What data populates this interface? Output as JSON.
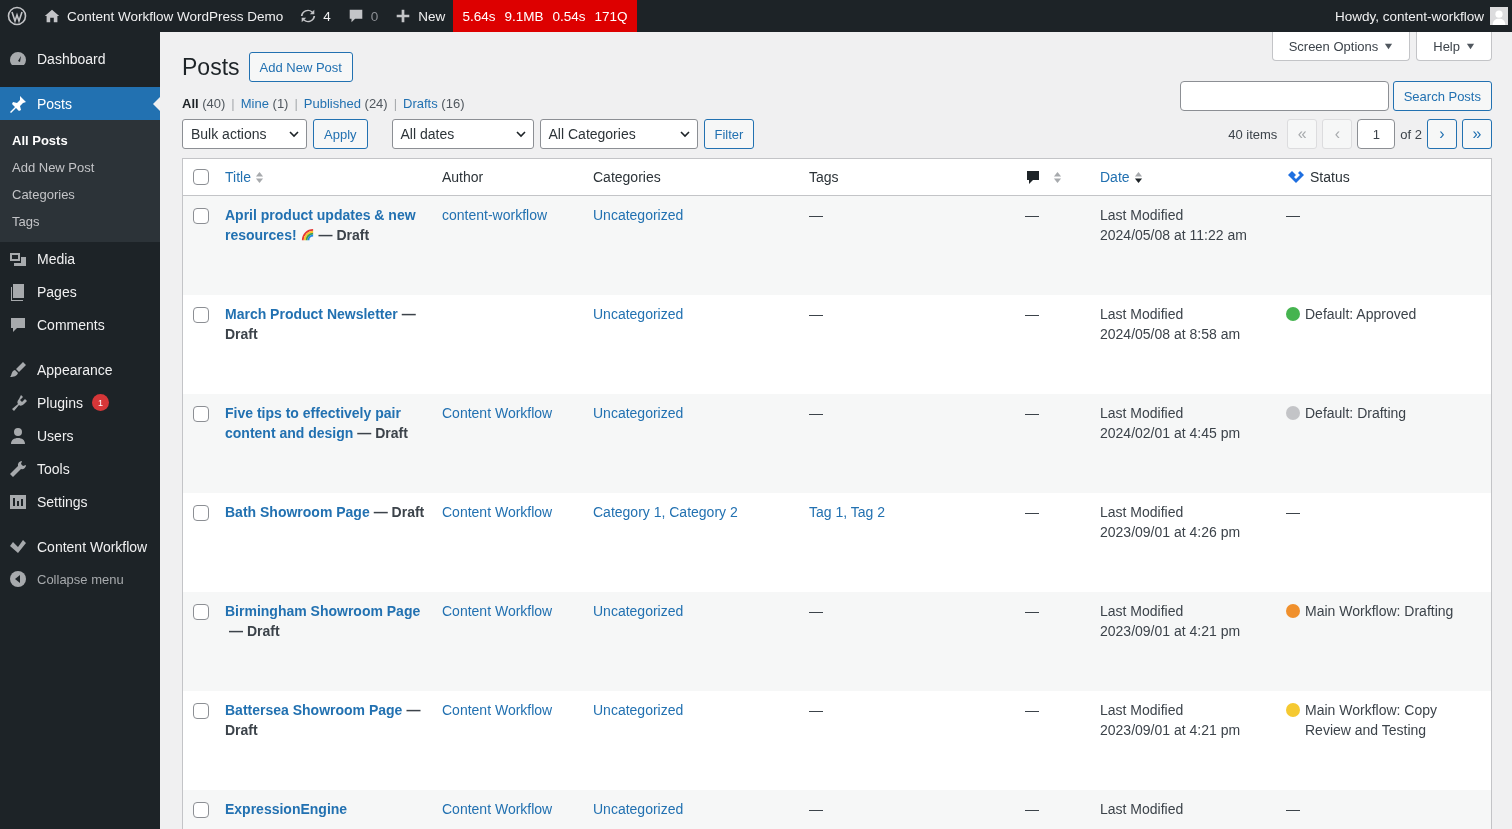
{
  "admin_bar": {
    "site_title": "Content Workflow WordPress Demo",
    "updates_count": "4",
    "comments_count": "0",
    "new_label": "New",
    "perf": [
      "5.64s",
      "9.1MB",
      "0.54s",
      "171Q"
    ],
    "greeting": "Howdy, content-workflow"
  },
  "sidebar": {
    "groups": [
      [
        {
          "label": "Dashboard",
          "selected": false
        }
      ],
      [
        {
          "label": "Posts",
          "selected": true,
          "children": [
            {
              "label": "All Posts",
              "selected": true
            },
            {
              "label": "Add New Post",
              "selected": false
            },
            {
              "label": "Categories",
              "selected": false
            },
            {
              "label": "Tags",
              "selected": false
            }
          ]
        },
        {
          "label": "Media",
          "selected": false
        },
        {
          "label": "Pages",
          "selected": false
        },
        {
          "label": "Comments",
          "selected": false
        }
      ],
      [
        {
          "label": "Appearance",
          "selected": false
        },
        {
          "label": "Plugins",
          "selected": false,
          "badge": "1"
        },
        {
          "label": "Users",
          "selected": false
        },
        {
          "label": "Tools",
          "selected": false
        },
        {
          "label": "Settings",
          "selected": false
        }
      ],
      [
        {
          "label": "Content Workflow",
          "selected": false
        }
      ]
    ],
    "collapse_label": "Collapse menu"
  },
  "screen_tabs": [
    "Screen Options",
    "Help"
  ],
  "page_title": "Posts",
  "add_new": "Add New Post",
  "views": [
    {
      "label": "All",
      "count": "(40)",
      "selected": true
    },
    {
      "separator": "|",
      "label": "Mine",
      "count": "(1)",
      "selected": false
    },
    {
      "separator": "|",
      "label": "Published",
      "count": "(24)",
      "selected": false
    },
    {
      "separator": "|",
      "label": "Drafts",
      "count": "(16)",
      "selected": false
    }
  ],
  "search": {
    "button": "Search Posts"
  },
  "filters": {
    "bulk": "Bulk actions",
    "apply": "Apply",
    "dates": "All dates",
    "categories": "All Categories",
    "filter": "Filter"
  },
  "pagination": {
    "count": "40 items",
    "first": {
      "label": "«",
      "disabled": true
    },
    "prev": {
      "label": "‹",
      "disabled": true
    },
    "page": "1",
    "of": "of 2",
    "next": {
      "label": "›",
      "disabled": false
    },
    "last": {
      "label": "»",
      "disabled": false
    }
  },
  "table": {
    "select_all_checked": false,
    "columns": [
      {
        "label": "Title",
        "sorted": false
      },
      {
        "label": "Author"
      },
      {
        "label": "Categories"
      },
      {
        "label": "Tags"
      },
      {
        "sorted": false
      },
      {
        "label": "Date",
        "sorted": true
      },
      {
        "label": "Status"
      }
    ],
    "rows": [
      {
        "checked": false,
        "title": "April product updates & new resources!",
        "has_icon": true,
        "state": "— Draft",
        "author": "content-workflow",
        "categories": "Uncategorized",
        "tags": {
          "text": "—",
          "link": false
        },
        "comments": "—",
        "date_label": "Last Modified",
        "date": "2024/05/08 at 11:22 am",
        "status": {
          "text": "—"
        }
      },
      {
        "checked": false,
        "title": "March Product Newsletter",
        "state": "— Draft",
        "categories": "Uncategorized",
        "tags": {
          "text": "—",
          "link": false
        },
        "comments": "—",
        "date_label": "Last Modified",
        "date": "2024/05/08 at 8:58 am",
        "status": {
          "text": "Default: Approved",
          "color": "#46b450"
        }
      },
      {
        "checked": false,
        "title": "Five tips to effectively pair content and design",
        "state": "— Draft",
        "author": "Content Workflow",
        "categories": "Uncategorized",
        "tags": {
          "text": "—",
          "link": false
        },
        "comments": "—",
        "date_label": "Last Modified",
        "date": "2024/02/01 at 4:45 pm",
        "status": {
          "text": "Default: Drafting",
          "color": "#c3c4c7"
        }
      },
      {
        "checked": false,
        "title": "Bath Showroom Page",
        "state": "— Draft",
        "author": "Content Workflow",
        "categories": "Category 1, Category 2",
        "tags": {
          "text": "Tag 1, Tag 2",
          "link": true
        },
        "comments": "—",
        "date_label": "Last Modified",
        "date": "2023/09/01 at 4:26 pm",
        "status": {
          "text": "—"
        }
      },
      {
        "checked": false,
        "title": "Birmingham Showroom Page",
        "state": "— Draft",
        "author": "Content Workflow",
        "categories": "Uncategorized",
        "tags": {
          "text": "—",
          "link": false
        },
        "comments": "—",
        "date_label": "Last Modified",
        "date": "2023/09/01 at 4:21 pm",
        "status": {
          "text": "Main Workflow: Drafting",
          "color": "#f0902c"
        }
      },
      {
        "checked": false,
        "title": "Battersea Showroom Page",
        "state": "— Draft",
        "author": "Content Workflow",
        "categories": "Uncategorized",
        "tags": {
          "text": "—",
          "link": false
        },
        "comments": "—",
        "date_label": "Last Modified",
        "date": "2023/09/01 at 4:21 pm",
        "status": {
          "text": "Main Workflow: Copy Review and Testing",
          "color": "#f5c931"
        }
      },
      {
        "checked": false,
        "title": "ExpressionEngine",
        "author": "Content Workflow",
        "categories": "Uncategorized",
        "tags": {
          "text": "—",
          "link": false
        },
        "comments": "—",
        "date_label": "Last Modified",
        "status": {
          "text": "—"
        }
      }
    ]
  }
}
